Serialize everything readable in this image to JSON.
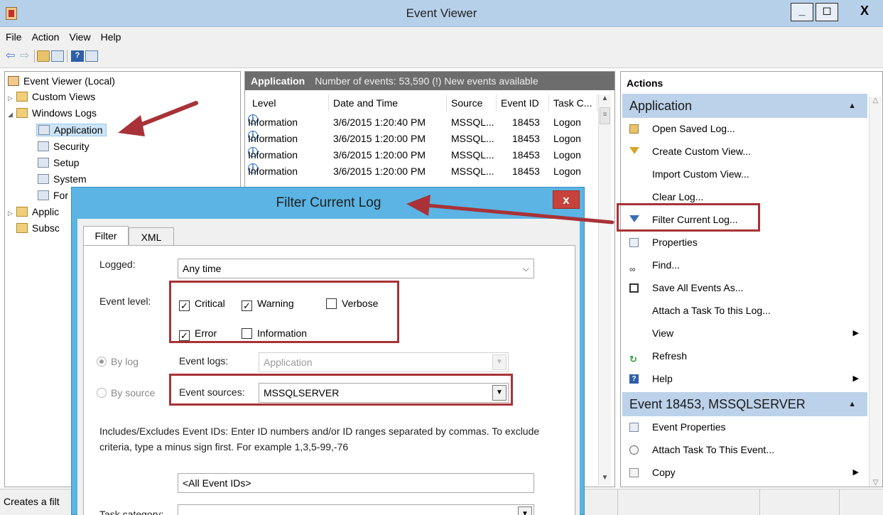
{
  "window": {
    "title": "Event Viewer",
    "minimize": "_",
    "maximize": "◻",
    "close": "X"
  },
  "menu": [
    "File",
    "Action",
    "View",
    "Help"
  ],
  "tree": {
    "root": "Event Viewer (Local)",
    "custom_views": "Custom Views",
    "windows_logs": "Windows Logs",
    "application": "Application",
    "security": "Security",
    "setup": "Setup",
    "system": "System",
    "forwarded": "For",
    "applications_services": "Applic",
    "subscriptions": "Subsc"
  },
  "center": {
    "header_title": "Application",
    "header_info": "Number of events: 53,590 (!) New events available",
    "columns": [
      "Level",
      "Date and Time",
      "Source",
      "Event ID",
      "Task C..."
    ],
    "rows": [
      {
        "level": "Information",
        "date": "3/6/2015 1:20:40 PM",
        "source": "MSSQL...",
        "id": "18453",
        "task": "Logon"
      },
      {
        "level": "Information",
        "date": "3/6/2015 1:20:00 PM",
        "source": "MSSQL...",
        "id": "18453",
        "task": "Logon"
      },
      {
        "level": "Information",
        "date": "3/6/2015 1:20:00 PM",
        "source": "MSSQL...",
        "id": "18453",
        "task": "Logon"
      },
      {
        "level": "Information",
        "date": "3/6/2015 1:20:00 PM",
        "source": "MSSQL...",
        "id": "18453",
        "task": "Logon"
      }
    ]
  },
  "actions": {
    "title": "Actions",
    "section1": "Application",
    "items1": [
      {
        "label": "Open Saved Log...",
        "icon": "open-folder-icon"
      },
      {
        "label": "Create Custom View...",
        "icon": "funnel-icon"
      },
      {
        "label": "Import Custom View...",
        "icon": ""
      },
      {
        "label": "Clear Log...",
        "icon": ""
      },
      {
        "label": "Filter Current Log...",
        "icon": "filter-icon"
      },
      {
        "label": "Properties",
        "icon": "properties-icon"
      },
      {
        "label": "Find...",
        "icon": "binoculars-icon"
      },
      {
        "label": "Save All Events As...",
        "icon": "save-icon"
      },
      {
        "label": "Attach a Task To this Log...",
        "icon": ""
      },
      {
        "label": "View",
        "icon": ""
      },
      {
        "label": "Refresh",
        "icon": "refresh-icon"
      },
      {
        "label": "Help",
        "icon": "help-icon"
      }
    ],
    "section2": "Event 18453, MSSQLSERVER",
    "items2": [
      {
        "label": "Event Properties",
        "icon": "properties-icon"
      },
      {
        "label": "Attach Task To This Event...",
        "icon": "task-icon"
      },
      {
        "label": "Copy",
        "icon": "copy-icon"
      }
    ]
  },
  "status": {
    "text": "Creates a filt"
  },
  "dialog": {
    "title": "Filter Current Log",
    "close": "x",
    "tabs": [
      "Filter",
      "XML"
    ],
    "logged_label": "Logged:",
    "logged_value": "Any time",
    "event_level_label": "Event level:",
    "levels": {
      "critical": "Critical",
      "warning": "Warning",
      "verbose": "Verbose",
      "error": "Error",
      "information": "Information"
    },
    "by_log": "By log",
    "by_source": "By source",
    "event_logs_label": "Event logs:",
    "event_logs_value": "Application",
    "event_sources_label": "Event sources:",
    "event_sources_value": "MSSQLSERVER",
    "hint": "Includes/Excludes Event IDs: Enter ID numbers and/or ID ranges separated by commas. To exclude criteria, type a minus sign first. For example 1,3,5-99,-76",
    "event_ids_value": "<All Event IDs>",
    "task_category_label": "Task category:"
  },
  "colors": {
    "accent": "#bcd2ea",
    "annotation": "#a83237",
    "dialog_frame": "#5bb4e3"
  }
}
